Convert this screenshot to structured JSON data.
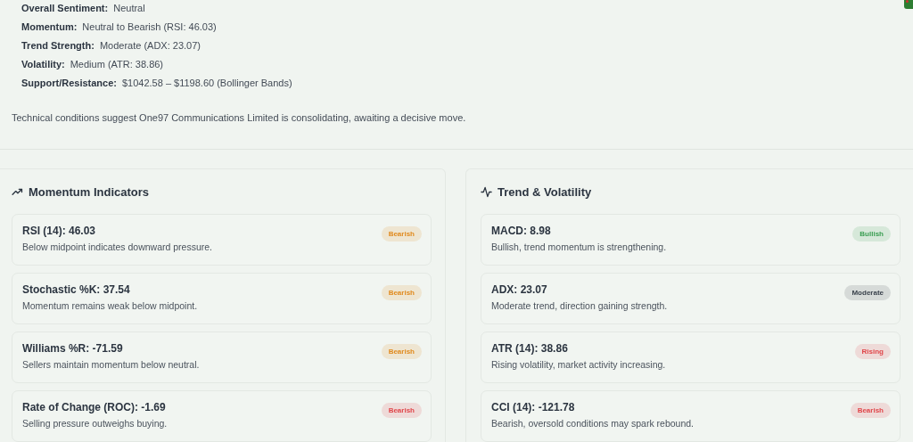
{
  "summary": [
    {
      "label": "Overall Sentiment:",
      "value": "Neutral"
    },
    {
      "label": "Momentum:",
      "value": "Neutral to Bearish (RSI: 46.03)"
    },
    {
      "label": "Trend Strength:",
      "value": "Moderate (ADX: 23.07)"
    },
    {
      "label": "Volatility:",
      "value": "Medium (ATR: 38.86)"
    },
    {
      "label": "Support/Resistance:",
      "value": "$1042.58 – $1198.60 (Bollinger Bands)"
    }
  ],
  "conclusion": "Technical conditions suggest One97 Communications Limited is consolidating, awaiting a decisive move.",
  "panels": [
    {
      "title": "Momentum Indicators",
      "indicators": [
        {
          "name": "RSI (14): 46.03",
          "description": "Below midpoint indicates downward pressure.",
          "badge": "Bearish",
          "color": "#e08a1e"
        },
        {
          "name": "Stochastic %K: 37.54",
          "description": "Momentum remains weak below midpoint.",
          "badge": "Bearish",
          "color": "#e08a1e"
        },
        {
          "name": "Williams %R: -71.59",
          "description": "Sellers maintain momentum below neutral.",
          "badge": "Bearish",
          "color": "#e08a1e"
        },
        {
          "name": "Rate of Change (ROC): -1.69",
          "description": "Selling pressure outweighs buying.",
          "badge": "Bearish",
          "color": "#e0464a"
        }
      ]
    },
    {
      "title": "Trend & Volatility",
      "indicators": [
        {
          "name": "MACD: 8.98",
          "description": "Bullish, trend momentum is strengthening.",
          "badge": "Bullish",
          "color": "#3a9e52"
        },
        {
          "name": "ADX: 23.07",
          "description": "Moderate trend, direction gaining strength.",
          "badge": "Moderate",
          "color": "#3a424c"
        },
        {
          "name": "ATR (14): 38.86",
          "description": "Rising volatility, market activity increasing.",
          "badge": "Rising",
          "color": "#e0464a"
        },
        {
          "name": "CCI (14): -121.78",
          "description": "Bearish, oversold conditions may spark rebound.",
          "badge": "Bearish",
          "color": "#e0464a"
        }
      ]
    }
  ]
}
